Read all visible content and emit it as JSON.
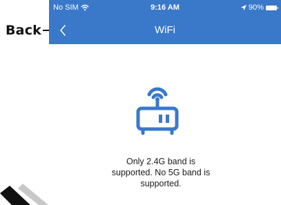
{
  "annotation": {
    "back_label": "Back"
  },
  "status_bar": {
    "carrier": "No SIM",
    "time": "9:16 AM",
    "battery": "90%"
  },
  "nav": {
    "title": "WiFi"
  },
  "main": {
    "icon": "router-icon",
    "message": "Only 2.4G band is supported. No 5G band is supported."
  },
  "colors": {
    "accent": "#3a78c9",
    "text": "#1a1a1a"
  }
}
